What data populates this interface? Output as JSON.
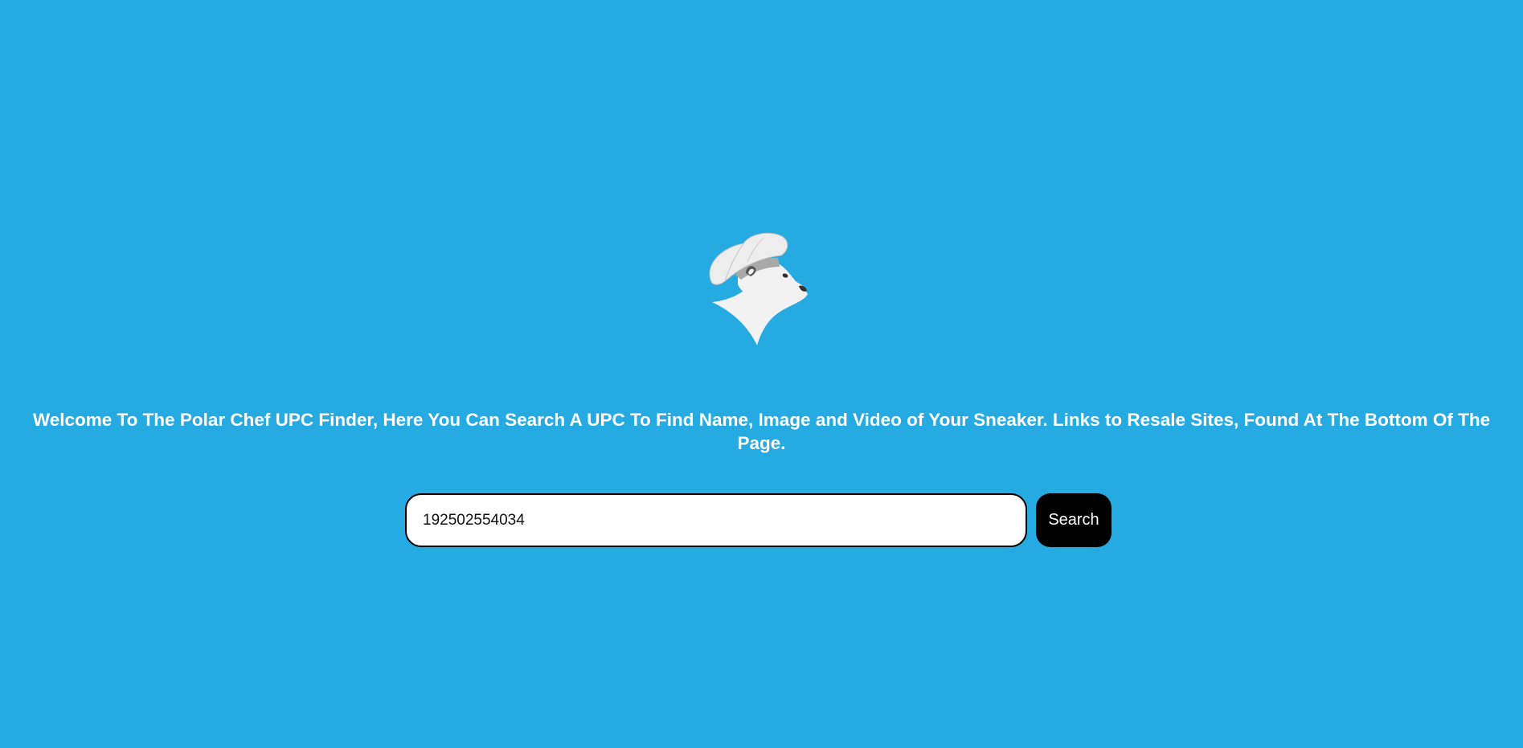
{
  "colors": {
    "background": "#25aae2",
    "heading_text": "#ffffff",
    "button_background": "#000000",
    "button_text": "#ffffff"
  },
  "logo": {
    "icon": "polar-bear-chef-icon"
  },
  "welcome": {
    "text": "Welcome To The Polar Chef UPC Finder, Here You Can Search A UPC To Find Name, Image and Video of Your Sneaker. Links to Resale Sites, Found At The Bottom Of The Page."
  },
  "search": {
    "value": "192502554034",
    "placeholder": "",
    "button_label": "Search"
  }
}
